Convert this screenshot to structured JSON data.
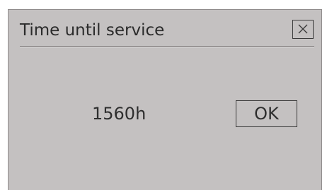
{
  "dialog": {
    "title": "Time until service",
    "close_icon": "close-icon",
    "value": "1560h",
    "ok_label": "OK"
  },
  "colors": {
    "dialog_background": "#c4c1c1",
    "text": "#2e2e2e",
    "border": "#3a3a3a",
    "page_background": "#ffffff"
  }
}
